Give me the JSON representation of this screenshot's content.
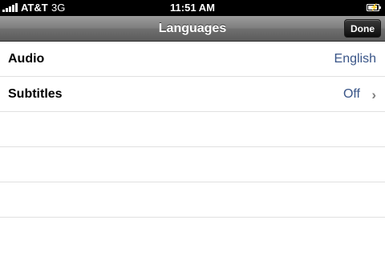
{
  "status_bar": {
    "carrier": "AT&T",
    "network": "3G",
    "time": "11:51 AM"
  },
  "nav_bar": {
    "title": "Languages",
    "done_label": "Done"
  },
  "rows": [
    {
      "label": "Audio",
      "value": "English"
    },
    {
      "label": "Subtitles",
      "value": "Off"
    }
  ]
}
